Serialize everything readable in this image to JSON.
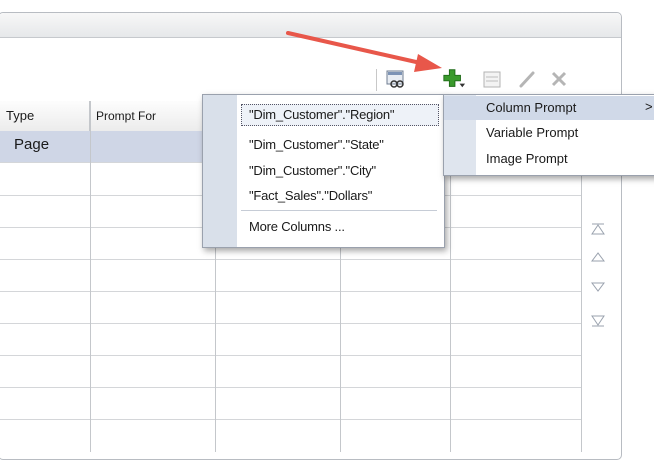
{
  "table": {
    "headers": [
      "Type",
      "Prompt For"
    ],
    "first_row_type": "Page"
  },
  "toolbar": {
    "icons": [
      "preview-icon",
      "add-icon",
      "properties-icon",
      "edit-icon",
      "delete-icon"
    ]
  },
  "columns_menu": {
    "items": [
      "\"Dim_Customer\".\"Region\"",
      "\"Dim_Customer\".\"State\"",
      "\"Dim_Customer\".\"City\"",
      "\"Fact_Sales\".\"Dollars\""
    ],
    "more": "More Columns ..."
  },
  "prompt_menu": {
    "items": [
      "Column Prompt",
      "Variable Prompt",
      "Image Prompt"
    ],
    "chevron": ">"
  },
  "colors": {
    "accent_arrow": "#e8574a",
    "selected_row": "#cfd6e6",
    "add_icon": "#3a9a2c"
  }
}
